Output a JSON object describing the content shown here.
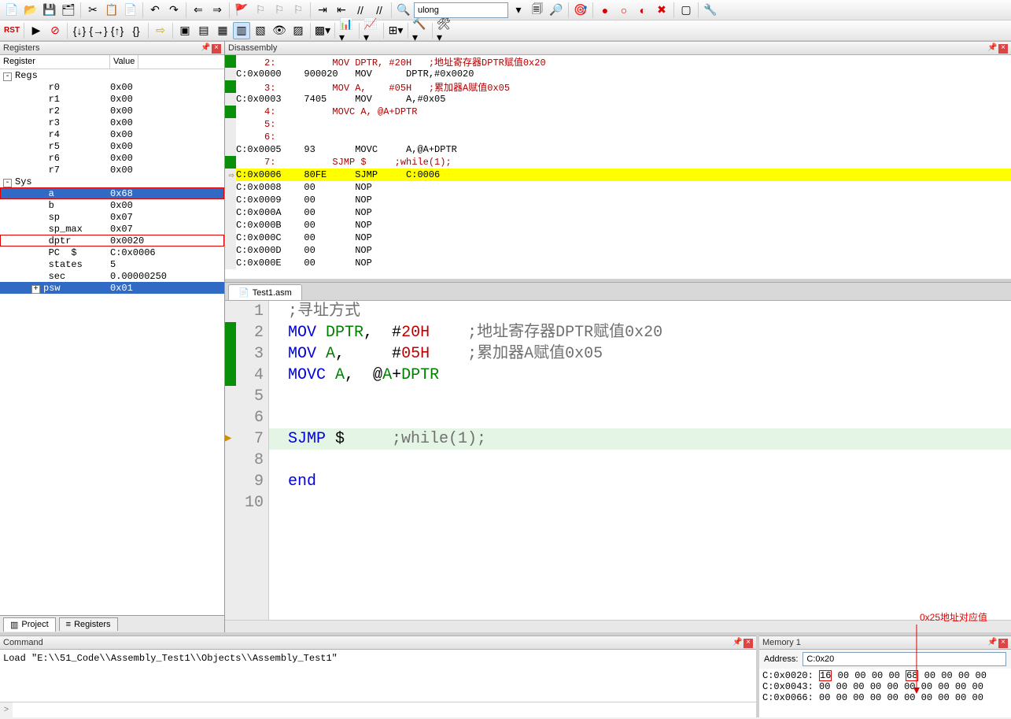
{
  "toolbar1": {
    "combo_value": "ulong"
  },
  "registers": {
    "title": "Registers",
    "col1": "Register",
    "col2": "Value",
    "groups": [
      {
        "label": "Regs",
        "exp": "-"
      },
      {
        "label": "Sys",
        "exp": "-"
      }
    ],
    "regs": [
      {
        "n": "r0",
        "v": "0x00"
      },
      {
        "n": "r1",
        "v": "0x00"
      },
      {
        "n": "r2",
        "v": "0x00"
      },
      {
        "n": "r3",
        "v": "0x00"
      },
      {
        "n": "r4",
        "v": "0x00"
      },
      {
        "n": "r5",
        "v": "0x00"
      },
      {
        "n": "r6",
        "v": "0x00"
      },
      {
        "n": "r7",
        "v": "0x00"
      }
    ],
    "sys": [
      {
        "n": "a",
        "v": "0x68",
        "sel": true,
        "box": true
      },
      {
        "n": "b",
        "v": "0x00"
      },
      {
        "n": "sp",
        "v": "0x07"
      },
      {
        "n": "sp_max",
        "v": "0x07"
      },
      {
        "n": "dptr",
        "v": "0x0020",
        "box": true
      },
      {
        "n": "PC  $",
        "v": "C:0x0006"
      },
      {
        "n": "states",
        "v": "5"
      },
      {
        "n": "sec",
        "v": "0.00000250"
      },
      {
        "n": "psw",
        "v": "0x01",
        "sel": true,
        "exp": "+"
      }
    ],
    "tabs": [
      {
        "label": "Project",
        "icon": "▥"
      },
      {
        "label": "Registers",
        "icon": "≡"
      }
    ]
  },
  "disasm": {
    "title": "Disassembly",
    "lines": [
      {
        "g": true,
        "t": "     2:          MOV DPTR, #20H   ;地址寄存器DPTR赋值0x20",
        "red": true
      },
      {
        "t": "C:0x0000    900020   MOV      DPTR,#0x0020"
      },
      {
        "g": true,
        "t": "     3:          MOV A,    #05H   ;累加器A赋值0x05",
        "red": true
      },
      {
        "t": "C:0x0003    7405     MOV      A,#0x05"
      },
      {
        "g": true,
        "t": "     4:          MOVC A, @A+DPTR",
        "red": true
      },
      {
        "t": "     5:  ",
        "red": true
      },
      {
        "t": "     6:  ",
        "red": true
      },
      {
        "t": "C:0x0005    93       MOVC     A,@A+DPTR"
      },
      {
        "g": true,
        "t": "     7:          SJMP $     ;while(1);",
        "red": true
      },
      {
        "hl": true,
        "arrow": true,
        "t": "C:0x0006    80FE     SJMP     C:0006"
      },
      {
        "t": "C:0x0008    00       NOP      "
      },
      {
        "t": "C:0x0009    00       NOP      "
      },
      {
        "t": "C:0x000A    00       NOP      "
      },
      {
        "t": "C:0x000B    00       NOP      "
      },
      {
        "t": "C:0x000C    00       NOP      "
      },
      {
        "t": "C:0x000D    00       NOP      "
      },
      {
        "t": "C:0x000E    00       NOP      "
      }
    ]
  },
  "source": {
    "tab": "Test1.asm",
    "lines": [
      {
        "n": 1,
        "html": "<span class='kw-cmt'>;寻址方式</span>"
      },
      {
        "n": 2,
        "mk": true,
        "html": "<span class='kw-blue'>MOV</span> <span class='kw-id'>DPTR</span>,  #<span class='kw-num'>20H</span>    <span class='kw-cmt'>;地址寄存器DPTR赋值0x20</span>"
      },
      {
        "n": 3,
        "mk": true,
        "html": "<span class='kw-blue'>MOV</span> <span class='kw-id'>A</span>,     #<span class='kw-num'>05H</span>    <span class='kw-cmt'>;累加器A赋值0x05</span>"
      },
      {
        "n": 4,
        "mk": true,
        "html": "<span class='kw-blue'>MOVC</span> <span class='kw-id'>A</span>,  @<span class='kw-id'>A</span>+<span class='kw-id'>DPTR</span>"
      },
      {
        "n": 5,
        "html": ""
      },
      {
        "n": 6,
        "html": ""
      },
      {
        "n": 7,
        "cur": true,
        "arrow": true,
        "html": "<span class='kw-blue'>SJMP</span> $     <span class='kw-cmt'>;while(1);</span>"
      },
      {
        "n": 8,
        "html": ""
      },
      {
        "n": 9,
        "html": "<span class='kw-blue'>end</span>"
      },
      {
        "n": 10,
        "html": ""
      }
    ]
  },
  "command": {
    "title": "Command",
    "text": "Load \"E:\\\\51_Code\\\\Assembly_Test1\\\\Objects\\\\Assembly_Test1\""
  },
  "memory": {
    "title": "Memory 1",
    "addr_label": "Address:",
    "addr_value": "C:0x20",
    "rows": [
      {
        "a": "C:0x0020:",
        "b": [
          "16",
          "00",
          "00",
          "00",
          "00",
          "68",
          "00",
          "00",
          "00",
          "00"
        ],
        "box": [
          0,
          5
        ]
      },
      {
        "a": "C:0x0043:",
        "b": [
          "00",
          "00",
          "00",
          "00",
          "00",
          "00",
          "00",
          "00",
          "00",
          "00"
        ]
      },
      {
        "a": "C:0x0066:",
        "b": [
          "00",
          "00",
          "00",
          "00",
          "00",
          "00",
          "00",
          "00",
          "00",
          "00"
        ]
      }
    ]
  },
  "annotation": "0x25地址对应值"
}
